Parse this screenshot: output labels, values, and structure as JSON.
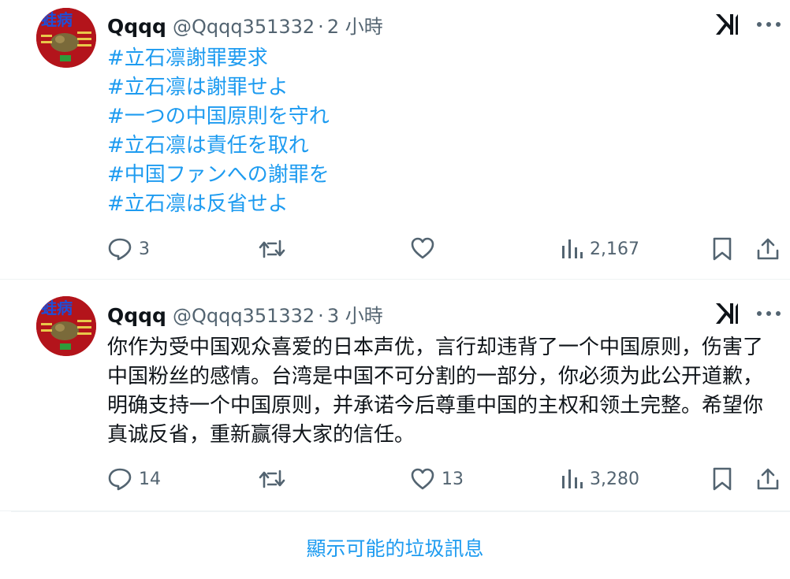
{
  "tweets": [
    {
      "display_name": "Qqqq",
      "handle": "@Qqqq351332",
      "separator": "·",
      "time": "2 小時",
      "hashtags": [
        "#立石凛謝罪要求",
        "#立石凛は謝罪せよ",
        "#一つの中国原則を守れ",
        "#立石凛は責任を取れ",
        "#中国ファンへの謝罪を",
        "#立石凛は反省せよ"
      ],
      "text": "",
      "replies": "3",
      "retweets": "",
      "likes": "",
      "views": "2,167"
    },
    {
      "display_name": "Qqqq",
      "handle": "@Qqqq351332",
      "separator": "·",
      "time": "3 小時",
      "hashtags": [],
      "text": "你作为受中国观众喜爱的日本声优，言行却违背了一个中国原则，伤害了中国粉丝的感情。台湾是中国不可分割的一部分，你必须为此公开道歉，明确支持一个中国原则，并承诺今后尊重中国的主权和领土完整。希望你真诚反省，重新赢得大家的信任。",
      "replies": "14",
      "retweets": "",
      "likes": "13",
      "views": "3,280"
    }
  ],
  "show_spam_label": "顯示可能的垃圾訊息",
  "colors": {
    "link": "#1d9bf0",
    "muted": "#536471",
    "text": "#0f1419",
    "avatar_bg": "#b3141b",
    "avatar_text": "#1d4fd8"
  },
  "icons": [
    "avatar-image",
    "grok-icon",
    "more-icon",
    "reply-icon",
    "retweet-icon",
    "like-icon",
    "views-icon",
    "bookmark-icon",
    "share-icon"
  ],
  "avatar_banner": "蛙病"
}
